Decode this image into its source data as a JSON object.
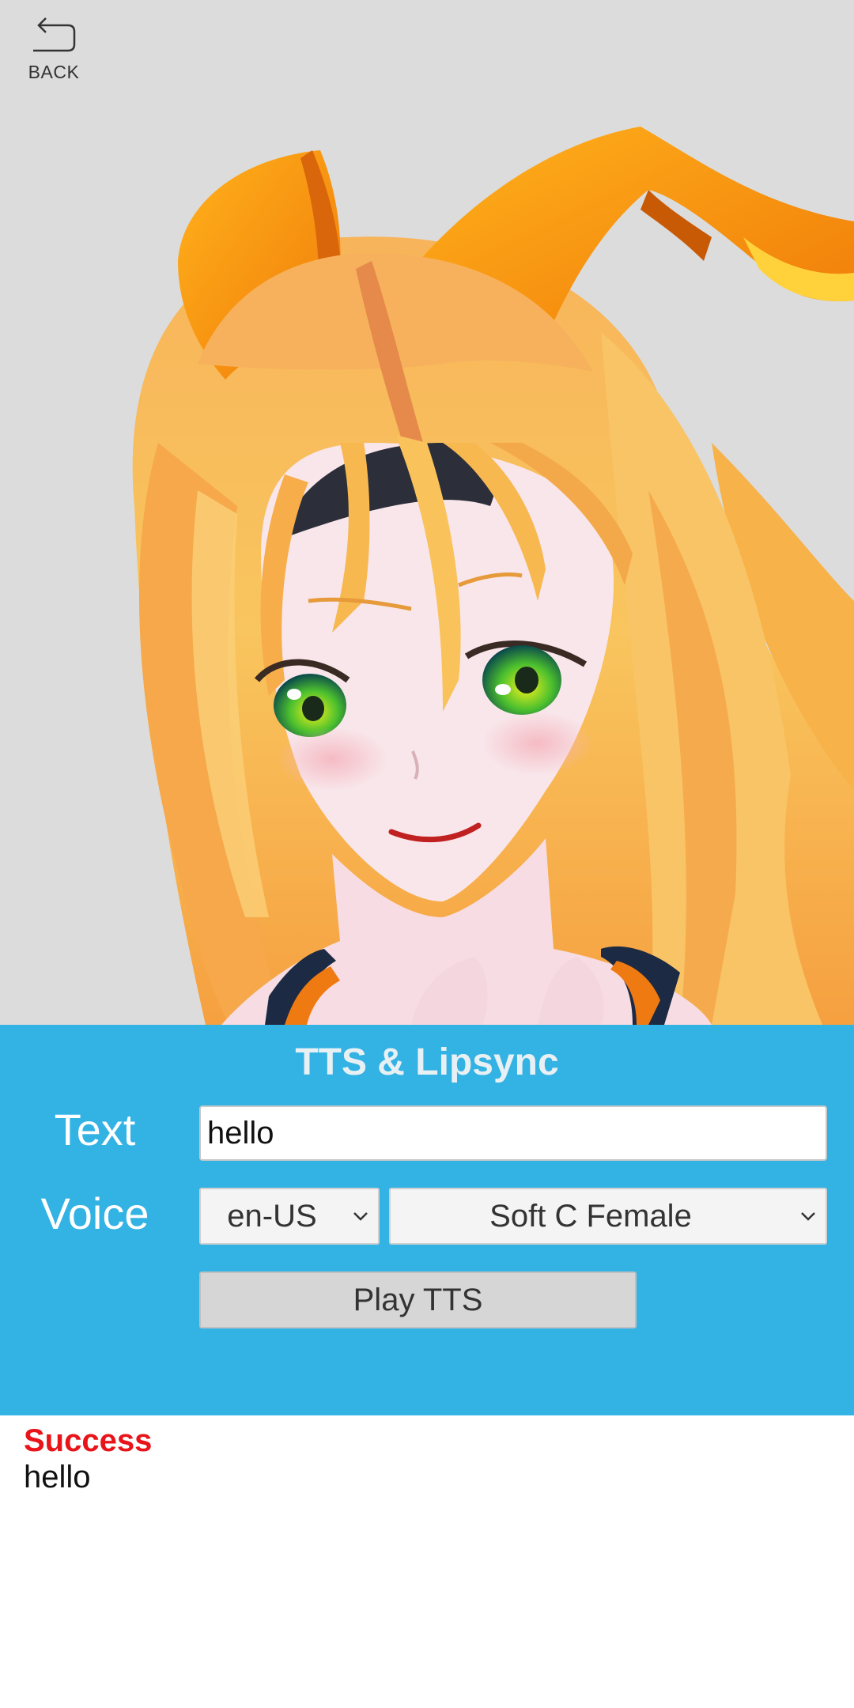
{
  "header": {
    "back_label": "BACK",
    "back_icon": "back-arrow-icon"
  },
  "scene": {
    "background_color": "#dcdcdc",
    "subject": "3D anime character with long blonde hair, orange bunny-ear ribbons, black headband and green eyes"
  },
  "panel": {
    "title": "TTS & Lipsync",
    "background_color": "#33b2e4",
    "text_label": "Text",
    "text_value": "hello",
    "voice_label": "Voice",
    "locale_selected": "en-US",
    "voice_selected": "Soft C Female",
    "play_label": "Play TTS"
  },
  "log": {
    "status": "Success",
    "status_color": "#e8141a",
    "result": "hello"
  }
}
